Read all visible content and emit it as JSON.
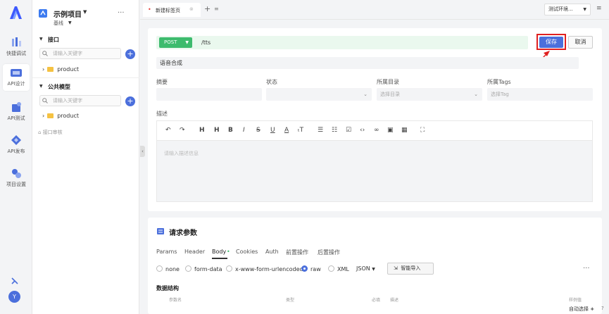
{
  "rail": {
    "items": [
      {
        "label": "快捷调试"
      },
      {
        "label": "API设计"
      },
      {
        "label": "API测试"
      },
      {
        "label": "API发布"
      },
      {
        "label": "项目设置"
      }
    ],
    "avatar": "Y"
  },
  "sidebar": {
    "project_name": "示例项目",
    "branch": "基线",
    "more": "···",
    "interface_section": "接口",
    "model_section": "公共模型",
    "search_placeholder": "请输入关键字",
    "folder1": "product",
    "folder2": "product",
    "review": "接口审核"
  },
  "tabs": {
    "active_tab": "新建标签页",
    "env": "测试环境..."
  },
  "request": {
    "method": "POST",
    "path": "/tts",
    "save": "保存",
    "cancel": "取消",
    "name": "语音合成"
  },
  "meta": {
    "summary_label": "摘要",
    "status_label": "状态",
    "dir_label": "所属目录",
    "dir_placeholder": "选择目录",
    "tags_label": "所属Tags",
    "tags_placeholder": "选择Tag",
    "desc_label": "描述",
    "editor_placeholder": "请输入描述信息"
  },
  "params": {
    "title": "请求参数",
    "tabs": [
      "Params",
      "Header",
      "Body",
      "Cookies",
      "Auth",
      "前置操作",
      "后置操作"
    ],
    "body_types": [
      "none",
      "form-data",
      "x-www-form-urlencoded",
      "raw",
      "XML"
    ],
    "format": "JSON",
    "smart_import": "智能导入",
    "structure_title": "数据结构",
    "col_name": "参数名",
    "col_type": "类型",
    "col_required": "必填",
    "col_desc": "描述",
    "col_example": "样例值",
    "more": "···"
  },
  "footer": {
    "auto_select": "自动选择"
  }
}
